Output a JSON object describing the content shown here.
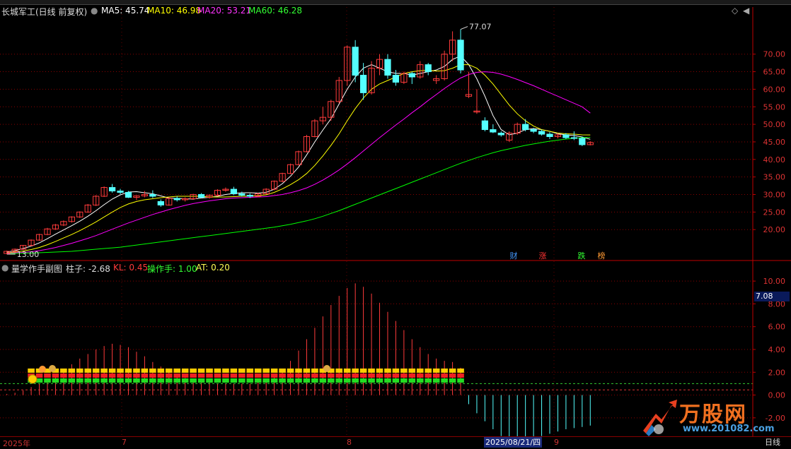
{
  "main_legend": {
    "stock": "长城军工(日线 前复权)",
    "ma5": "MA5: 45.74",
    "ma10": "MA10: 46.98",
    "ma20": "MA20: 53.21",
    "ma60": "MA60: 46.28"
  },
  "sub_legend": {
    "name": "量学作手副图",
    "zhuzi": "柱子: -2.68",
    "kl": "KL: 0.45",
    "czs": "操作手: 1.00",
    "at": "AT: 0.20"
  },
  "colors": {
    "up": "#ff3b3b",
    "down": "#54ffff",
    "ma5": "#ffffff",
    "ma10": "#ffff00",
    "ma20": "#ff00ff",
    "ma60": "#00ff00",
    "grid": "#8b0000",
    "axis": "#c00000"
  },
  "current_value": "7.08",
  "date_selected": "2025/08/21/四",
  "period": "日线",
  "event_tags": [
    "财",
    "涨",
    "跌",
    "榜"
  ],
  "watermark": {
    "brand": "万股网",
    "url": "www.201082.com"
  },
  "chart_data": [
    {
      "type": "candlestick",
      "title": "长城军工(日线 前复权)",
      "ylim": [
        13,
        80
      ],
      "y_ticks": [
        "70.00",
        "65.00",
        "60.00",
        "55.00",
        "50.00",
        "45.00",
        "40.00",
        "35.00",
        "30.00",
        "25.00",
        "20.00"
      ],
      "x_ticks": [
        "2025年",
        "7",
        "8",
        "9"
      ],
      "annotations": {
        "high": "77.07",
        "low": "13.00"
      },
      "candles": [
        [
          13.2,
          14.0,
          13.0,
          13.8
        ],
        [
          13.8,
          14.6,
          13.6,
          14.4
        ],
        [
          14.4,
          15.6,
          14.2,
          15.5
        ],
        [
          15.5,
          17.2,
          15.2,
          17.0
        ],
        [
          17.0,
          18.8,
          16.8,
          18.6
        ],
        [
          18.6,
          20.5,
          18.4,
          20.2
        ],
        [
          20.2,
          21.6,
          19.9,
          21.3
        ],
        [
          21.3,
          22.6,
          21.0,
          22.3
        ],
        [
          22.3,
          23.8,
          22.0,
          23.6
        ],
        [
          23.6,
          25.2,
          23.3,
          25.0
        ],
        [
          25.0,
          27.3,
          24.8,
          27.0
        ],
        [
          27.0,
          29.8,
          26.7,
          29.5
        ],
        [
          29.5,
          32.3,
          29.3,
          32.0
        ],
        [
          32.0,
          33.0,
          30.5,
          31.0
        ],
        [
          31.0,
          31.6,
          30.1,
          30.6
        ],
        [
          30.6,
          31.0,
          29.0,
          29.2
        ],
        [
          29.2,
          29.8,
          28.4,
          29.6
        ],
        [
          29.6,
          31.0,
          29.2,
          30.0
        ],
        [
          30.0,
          31.2,
          29.0,
          29.5
        ],
        [
          28.0,
          28.6,
          26.5,
          27.0
        ],
        [
          27.0,
          29.2,
          26.8,
          28.9
        ],
        [
          28.9,
          29.5,
          28.0,
          28.5
        ],
        [
          28.5,
          29.2,
          28.0,
          28.8
        ],
        [
          28.8,
          30.2,
          28.5,
          30.0
        ],
        [
          30.0,
          30.4,
          29.0,
          29.2
        ],
        [
          29.2,
          30.0,
          28.8,
          29.8
        ],
        [
          29.8,
          31.5,
          29.5,
          31.2
        ],
        [
          31.2,
          32.0,
          30.8,
          31.5
        ],
        [
          31.5,
          32.2,
          29.8,
          30.2
        ],
        [
          30.2,
          30.8,
          29.4,
          29.8
        ],
        [
          29.8,
          30.3,
          29.0,
          29.5
        ],
        [
          29.5,
          30.5,
          29.2,
          30.2
        ],
        [
          30.2,
          31.8,
          30.0,
          31.5
        ],
        [
          31.5,
          34.0,
          31.2,
          33.8
        ],
        [
          33.8,
          36.2,
          33.5,
          36.0
        ],
        [
          36.0,
          38.8,
          35.8,
          38.5
        ],
        [
          38.5,
          42.5,
          38.3,
          42.2
        ],
        [
          42.2,
          47.0,
          42.0,
          46.5
        ],
        [
          46.5,
          51.5,
          46.3,
          51.0
        ],
        [
          51.0,
          55.0,
          50.0,
          52.0
        ],
        [
          52.0,
          57.0,
          51.0,
          56.5
        ],
        [
          56.5,
          63.5,
          56.0,
          62.5
        ],
        [
          62.5,
          72.5,
          61.0,
          72.0
        ],
        [
          72.0,
          74.0,
          62.0,
          64.0
        ],
        [
          64.0,
          67.5,
          57.0,
          59.0
        ],
        [
          59.0,
          68.0,
          58.5,
          66.0
        ],
        [
          66.0,
          70.0,
          64.0,
          68.5
        ],
        [
          68.5,
          70.0,
          63.0,
          64.0
        ],
        [
          64.0,
          65.5,
          61.0,
          62.0
        ],
        [
          62.0,
          65.0,
          61.5,
          64.5
        ],
        [
          64.5,
          65.0,
          61.5,
          63.5
        ],
        [
          63.5,
          68.0,
          63.0,
          67.0
        ],
        [
          67.0,
          67.5,
          64.0,
          65.0
        ],
        [
          62.5,
          64.0,
          61.5,
          63.0
        ],
        [
          63.0,
          71.0,
          62.5,
          70.0
        ],
        [
          70.0,
          76.5,
          68.0,
          74.0
        ],
        [
          74.0,
          77.07,
          64.5,
          65.5
        ],
        [
          58.0,
          65.0,
          57.5,
          58.5
        ],
        [
          53.5,
          60.0,
          53.0,
          53.8
        ],
        [
          51.0,
          52.0,
          48.0,
          48.5
        ],
        [
          48.5,
          50.0,
          47.5,
          47.8
        ],
        [
          47.5,
          48.0,
          46.5,
          47.0
        ],
        [
          45.5,
          48.0,
          45.0,
          47.5
        ],
        [
          47.5,
          50.5,
          47.0,
          50.0
        ],
        [
          50.0,
          51.5,
          48.0,
          48.5
        ],
        [
          48.5,
          49.0,
          47.5,
          48.0
        ],
        [
          48.0,
          48.5,
          46.8,
          47.2
        ],
        [
          47.2,
          47.8,
          45.8,
          46.5
        ],
        [
          46.5,
          47.5,
          46.0,
          47.0
        ],
        [
          47.0,
          47.5,
          45.8,
          46.2
        ],
        [
          46.2,
          48.0,
          45.5,
          46.0
        ],
        [
          46.0,
          46.5,
          43.8,
          44.2
        ],
        [
          44.2,
          45.2,
          44.0,
          44.8
        ]
      ],
      "series": [
        {
          "name": "MA5",
          "values": [
            13.6,
            14.0,
            14.6,
            15.3,
            16.2,
            17.4,
            18.7,
            19.9,
            21.1,
            22.4,
            23.8,
            25.4,
            27.1,
            28.7,
            29.9,
            30.7,
            30.8,
            30.5,
            30.2,
            29.6,
            29.0,
            28.9,
            28.8,
            28.7,
            29.0,
            29.2,
            29.5,
            30.0,
            30.3,
            30.5,
            30.5,
            30.4,
            30.6,
            31.5,
            33.1,
            35.2,
            37.8,
            41.3,
            45.0,
            48.4,
            51.6,
            55.8,
            60.0,
            63.5,
            66.0,
            67.0,
            66.0,
            65.0,
            64.5,
            64.5,
            64.0,
            64.5,
            65.0,
            65.5,
            66.5,
            68.5,
            69.5,
            67.0,
            63.0,
            58.0,
            52.5,
            48.5,
            47.0,
            47.5,
            48.5,
            48.8,
            48.5,
            48.0,
            47.3,
            47.0,
            46.8,
            46.4,
            45.74
          ]
        },
        {
          "name": "MA10",
          "values": [
            13.4,
            13.6,
            13.9,
            14.3,
            14.9,
            15.7,
            16.6,
            17.6,
            18.6,
            19.7,
            20.9,
            22.2,
            23.6,
            25.0,
            26.3,
            27.3,
            28.0,
            28.5,
            28.8,
            29.1,
            29.3,
            29.5,
            29.5,
            29.5,
            29.5,
            29.3,
            29.3,
            29.3,
            29.4,
            29.5,
            29.5,
            29.7,
            29.9,
            30.6,
            31.6,
            32.8,
            34.2,
            36.0,
            38.3,
            41.0,
            44.0,
            47.3,
            51.0,
            54.5,
            57.5,
            60.0,
            61.5,
            62.5,
            63.5,
            64.5,
            65.0,
            65.3,
            65.4,
            65.2,
            65.3,
            66.0,
            67.0,
            67.0,
            66.0,
            64.0,
            61.5,
            58.5,
            55.5,
            53.0,
            51.0,
            49.5,
            48.5,
            48.0,
            47.5,
            47.3,
            47.2,
            47.0,
            46.98
          ]
        },
        {
          "name": "MA20",
          "values": [
            13.3,
            13.4,
            13.5,
            13.7,
            14.0,
            14.4,
            14.9,
            15.5,
            16.1,
            16.8,
            17.5,
            18.3,
            19.2,
            20.1,
            21.0,
            21.9,
            22.7,
            23.5,
            24.3,
            25.0,
            25.7,
            26.3,
            26.9,
            27.4,
            27.8,
            28.2,
            28.5,
            28.8,
            29.0,
            29.1,
            29.2,
            29.3,
            29.4,
            29.7,
            30.0,
            30.5,
            31.1,
            31.9,
            32.9,
            34.1,
            35.5,
            37.0,
            38.7,
            40.5,
            42.4,
            44.3,
            46.2,
            48.0,
            49.8,
            51.5,
            53.3,
            55.0,
            56.8,
            58.5,
            60.2,
            61.8,
            63.2,
            64.2,
            64.8,
            65.0,
            64.8,
            64.3,
            63.6,
            62.8,
            61.9,
            61.0,
            60.0,
            59.0,
            58.0,
            57.0,
            56.0,
            55.0,
            53.21
          ]
        },
        {
          "name": "MA60",
          "values": [
            13.2,
            13.2,
            13.3,
            13.3,
            13.4,
            13.5,
            13.6,
            13.7,
            13.8,
            14.0,
            14.2,
            14.4,
            14.6,
            14.8,
            15.0,
            15.3,
            15.6,
            15.9,
            16.2,
            16.5,
            16.8,
            17.1,
            17.4,
            17.7,
            18.0,
            18.3,
            18.6,
            18.9,
            19.2,
            19.5,
            19.8,
            20.1,
            20.4,
            20.7,
            21.1,
            21.5,
            22.0,
            22.5,
            23.1,
            23.8,
            24.6,
            25.4,
            26.3,
            27.2,
            28.1,
            29.0,
            29.9,
            30.8,
            31.7,
            32.6,
            33.5,
            34.4,
            35.3,
            36.2,
            37.1,
            38.0,
            38.9,
            39.7,
            40.5,
            41.2,
            41.9,
            42.5,
            43.0,
            43.5,
            44.0,
            44.4,
            44.8,
            45.2,
            45.5,
            45.8,
            46.0,
            46.2,
            46.28
          ]
        }
      ]
    },
    {
      "type": "bar",
      "title": "量学作手副图",
      "ylim": [
        -3,
        11
      ],
      "y_ticks": [
        "10.00",
        "8.00",
        "6.00",
        "4.00",
        "2.00",
        "0.00",
        "-2.00"
      ],
      "series": [
        {
          "name": "柱子",
          "values": [
            0.1,
            0.2,
            0.4,
            0.7,
            1.0,
            1.4,
            1.8,
            2.2,
            2.7,
            3.2,
            3.6,
            4.0,
            4.3,
            4.5,
            4.4,
            4.2,
            3.8,
            3.4,
            2.9,
            2.5,
            2.1,
            1.8,
            1.5,
            1.3,
            1.2,
            1.1,
            1.0,
            1.0,
            1.0,
            1.0,
            1.0,
            1.1,
            1.3,
            1.7,
            2.3,
            3.0,
            3.9,
            4.9,
            5.9,
            6.9,
            7.9,
            8.7,
            9.4,
            9.8,
            9.5,
            8.9,
            8.1,
            7.3,
            6.5,
            5.7,
            4.9,
            4.2,
            3.6,
            3.2,
            3.0,
            2.9,
            2.4,
            -0.8,
            -1.6,
            -2.3,
            -3.0,
            -3.6,
            -3.9,
            -4.1,
            -4.0,
            -3.8,
            -3.6,
            -3.4,
            -3.2,
            -3.0,
            -2.9,
            -2.8,
            -2.68
          ]
        }
      ],
      "reference_lines": [
        1.0,
        0.45
      ]
    }
  ]
}
